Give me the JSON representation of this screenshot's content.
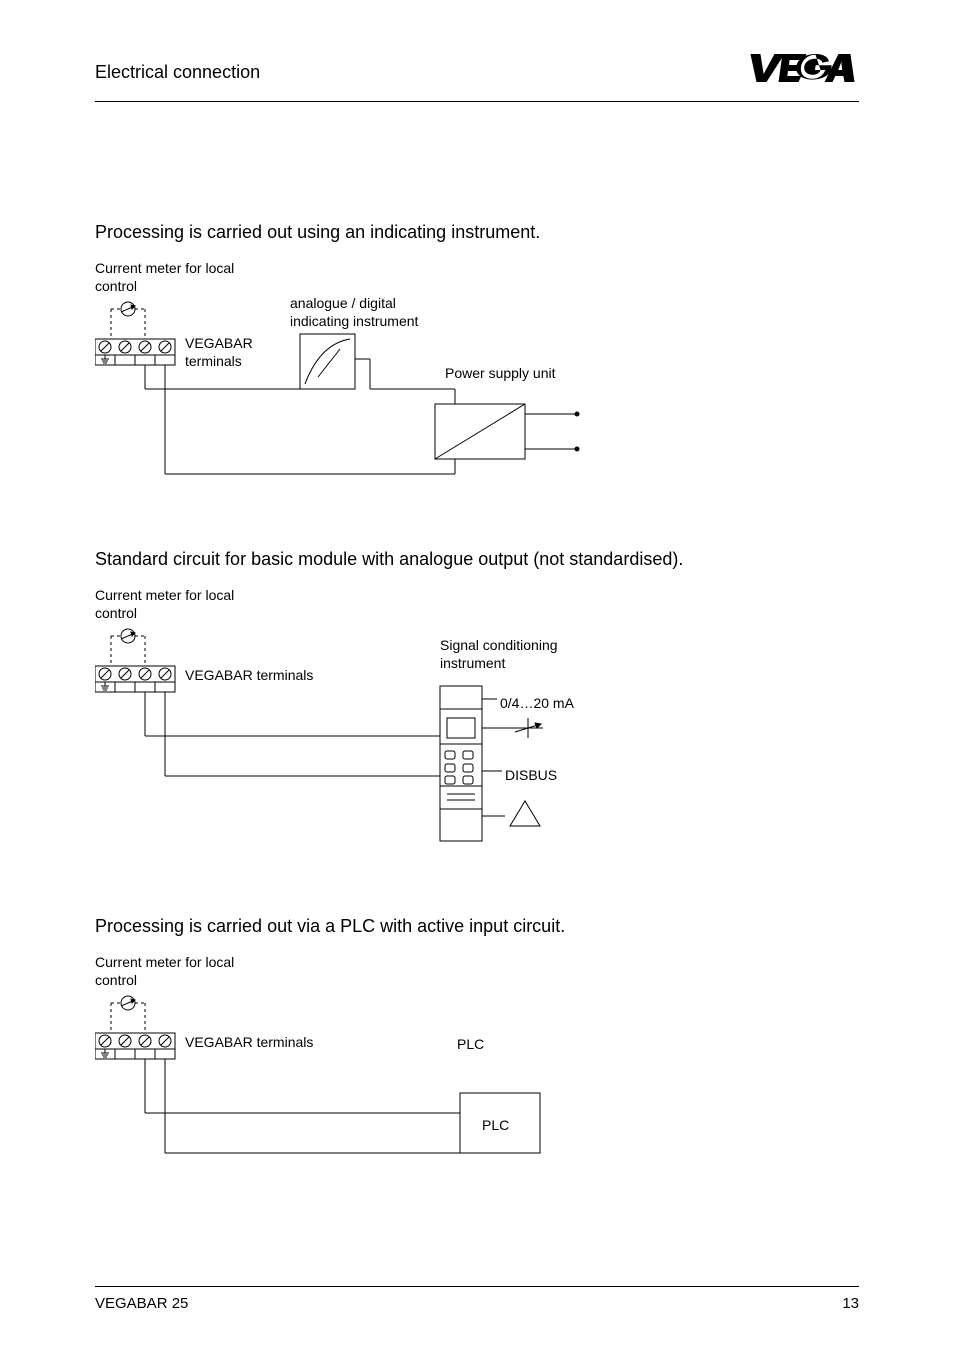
{
  "header": {
    "title": "Electrical connection",
    "logo": "VEGA"
  },
  "section1": {
    "text": "Processing is carried out using an indicating instrument.",
    "labels": {
      "meter": "Current meter for local control",
      "terminals": "VEGABAR terminals",
      "instrument": "analogue / digital indicating instrument",
      "psu": "Power supply unit"
    }
  },
  "section2": {
    "text": "Standard circuit for basic module with analogue output (not standardised).",
    "labels": {
      "meter": "Current meter for local control",
      "terminals": "VEGABAR terminals",
      "instrument": "Signal conditioning instrument",
      "out1": "0/4…20 mA",
      "out2": "DISBUS"
    }
  },
  "section3": {
    "text": "Processing is carried out via a PLC with active input circuit.",
    "labels": {
      "meter": "Current meter for local control",
      "terminals": "VEGABAR terminals",
      "plc_label": "PLC",
      "plc_box": "PLC"
    }
  },
  "footer": {
    "left": "VEGABAR 25",
    "right": "13"
  }
}
